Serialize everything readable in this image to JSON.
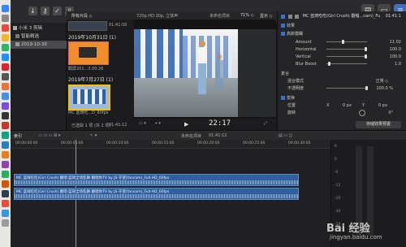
{
  "toolbar": {
    "browser_filter": "所有片段 ◇",
    "viewer_format": "720p HD 30p, 立体声",
    "project_name": "未命名项目",
    "zoom": "71% ◇",
    "display": "显示 ◇"
  },
  "library": {
    "items": [
      {
        "label": "小米 3 剪辑",
        "selected": false
      },
      {
        "label": "智能精选",
        "selected": false
      },
      {
        "label": "2019-10-30",
        "selected": true
      }
    ]
  },
  "browser": {
    "top_clip_duration": "01:41:00",
    "groups": [
      {
        "date": "2019年10月31日 (1)",
        "clip_name": "截屏201...3.00.26"
      },
      {
        "date": "2019年7月27日 (1)",
        "clip_name": "MC 蓝琦吃...D_60fps"
      }
    ],
    "status": "已选取 1 项 (共 2 项)",
    "status_duration": "01:41:12"
  },
  "viewer": {
    "timecode": "22:17",
    "fit_menu": "▾",
    "controls": [
      "▭ ▾",
      "⌖ ▾"
    ]
  },
  "inspector": {
    "header_title": "MC 蓝琦吃吃(Girl Crush) 翻唱...cam)_Full-HD_60fps",
    "header_time": "01:41:1",
    "effects_label": "效果",
    "effect_name": "高斯模糊",
    "params": [
      {
        "label": "Amount",
        "value": "11.02",
        "fill": 0.4
      },
      {
        "label": "Horizontal",
        "value": "100.0",
        "fill": 1.0
      },
      {
        "label": "Vertical",
        "value": "100.0",
        "fill": 1.0
      },
      {
        "label": "Blur Boost",
        "value": "1.0",
        "fill": 0.05
      }
    ],
    "composite_label": "复合",
    "blend_mode_label": "混合模式",
    "blend_mode_value": "正常 ◇",
    "opacity_label": "不透明度",
    "opacity_value": "100.0 %",
    "transform_label": "变换",
    "position_label": "位置",
    "pos_x_label": "X",
    "pos_x": "0 px",
    "pos_y_label": "Y",
    "pos_y": "0 px",
    "rotation_label": "旋转",
    "rotation_value": "0°",
    "save_preset": "存储效果预置"
  },
  "timeline": {
    "index_label": "索引",
    "project_name": "未命名项目",
    "duration": "01:41:12",
    "ruler_ticks": [
      "00:00:00:00",
      "00:00:05:00",
      "00:00:10:00",
      "00:00:15:00",
      "00:00:20:00",
      "00:00:25:00",
      "00:00:30:00"
    ],
    "clips": [
      {
        "label": "MC 蓝琦吃吃(Girl Crush) 翻唱·蓝琦全场乱舞 翻唱你TV by JS 守望(fancam)_Full-HD_60fps"
      },
      {
        "label": "MC 蓝琦吃吃(Girl Crush) 翻唱·蓝琦全场乱舞 翻唱你TV by JS 守望(fancam)_Full-HD_60fps"
      }
    ]
  },
  "meters": {
    "ticks": [
      "6",
      "0",
      "-6",
      "-12",
      "-20",
      "-30",
      "-50"
    ]
  },
  "watermark": {
    "brand": "Bai 经验",
    "url": "jingyan.baidu.com"
  }
}
